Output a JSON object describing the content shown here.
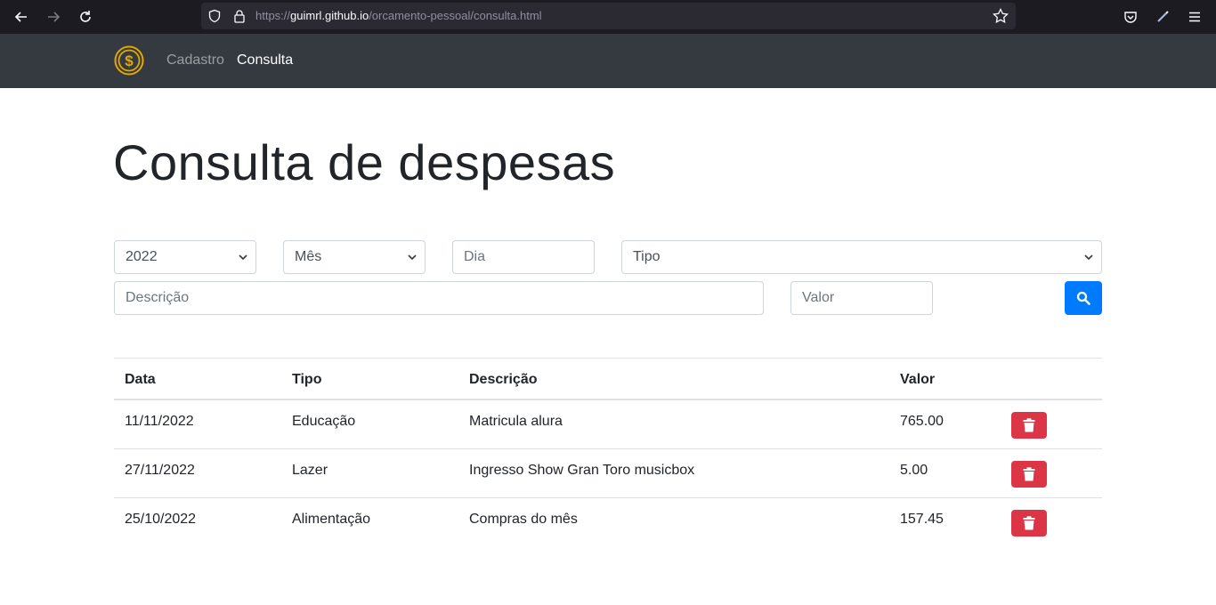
{
  "browser": {
    "url_prefix": "https://",
    "url_host": "guimrl.github.io",
    "url_path": "/orcamento-pessoal/consulta.html"
  },
  "navbar": {
    "links": [
      {
        "label": "Cadastro"
      },
      {
        "label": "Consulta"
      }
    ]
  },
  "page": {
    "title": "Consulta de despesas"
  },
  "filters": {
    "ano": "2022",
    "mes_placeholder": "Mês",
    "dia_placeholder": "Dia",
    "tipo_placeholder": "Tipo",
    "descricao_placeholder": "Descrição",
    "valor_placeholder": "Valor"
  },
  "table": {
    "headers": [
      "Data",
      "Tipo",
      "Descrição",
      "Valor"
    ],
    "rows": [
      {
        "data": "11/11/2022",
        "tipo": "Educação",
        "descricao": "Matricula alura",
        "valor": "765.00"
      },
      {
        "data": "27/11/2022",
        "tipo": "Lazer",
        "descricao": "Ingresso Show Gran Toro musicbox",
        "valor": "5.00"
      },
      {
        "data": "25/10/2022",
        "tipo": "Alimentação",
        "descricao": "Compras do mês",
        "valor": "157.45"
      }
    ]
  },
  "colors": {
    "navbar": "#343a40",
    "primary": "#007bff",
    "danger": "#dc3545",
    "logo": "#e0a800"
  }
}
